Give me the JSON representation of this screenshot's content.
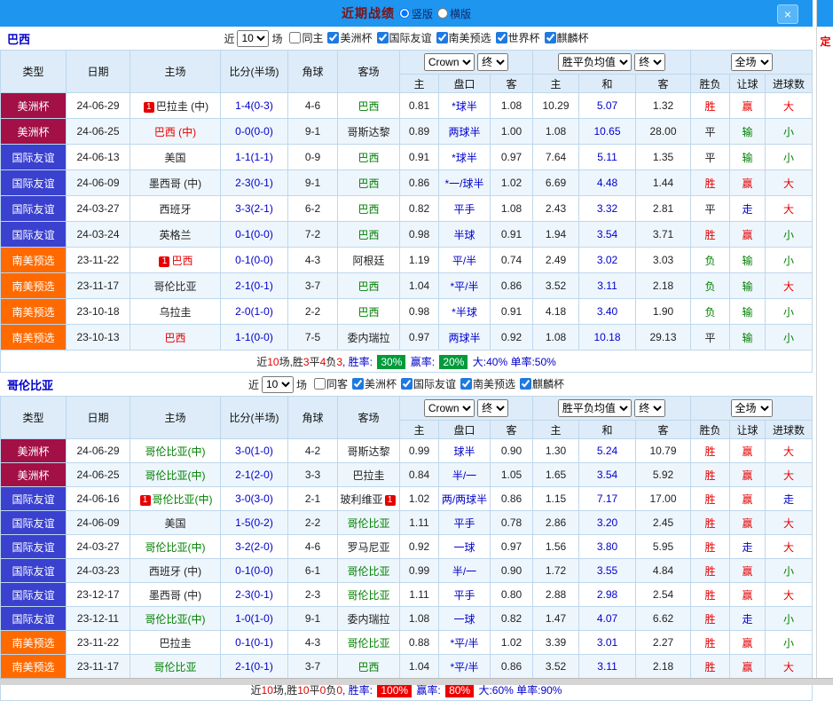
{
  "titlebar": {
    "title": "近期战绩",
    "radio1": "竖版",
    "radio2": "横版",
    "close": "×"
  },
  "side": {
    "label": "定"
  },
  "controls": {
    "near": "近",
    "games": "10",
    "games_suffix": "场",
    "company": "Crown",
    "end": "终",
    "wdl": "胜平负均值",
    "full": "全场"
  },
  "header_labels": {
    "type": "类型",
    "date": "日期",
    "home": "主场",
    "score": "比分(半场)",
    "corner": "角球",
    "away": "客场",
    "h1": "主",
    "h2": "盘口",
    "h3": "客",
    "h4": "主",
    "h5": "和",
    "h6": "客",
    "h7": "胜负",
    "h8": "让球",
    "h9": "进球数"
  },
  "sections": [
    {
      "team": "巴西",
      "filters": [
        {
          "label": "同主",
          "checked": false
        },
        {
          "label": "美洲杯",
          "checked": true
        },
        {
          "label": "国际友谊",
          "checked": true
        },
        {
          "label": "南美预选",
          "checked": true
        },
        {
          "label": "世界杯",
          "checked": true
        },
        {
          "label": "麒麟杯",
          "checked": true
        }
      ],
      "rows": [
        {
          "type": "美洲杯",
          "tclass": "copa",
          "date": "24-06-29",
          "home": "巴拉圭 (中)",
          "homeBadge": "1",
          "homeColor": "black",
          "score": "1-4(0-3)",
          "corner": "4-6",
          "away": "巴西",
          "awayBadge": "",
          "awayColor": "green",
          "aH": "0.81",
          "aP": "*球半",
          "aA": "1.08",
          "eH": "10.29",
          "eD": "5.07",
          "eA": "1.32",
          "res": "胜",
          "resC": "red",
          "han": "赢",
          "hanC": "red",
          "gol": "大",
          "golC": "red"
        },
        {
          "type": "美洲杯",
          "tclass": "copa",
          "date": "24-06-25",
          "home": "巴西 (中)",
          "homeBadge": "",
          "homeColor": "red",
          "score": "0-0(0-0)",
          "corner": "9-1",
          "away": "哥斯达黎",
          "awayBadge": "",
          "awayColor": "black",
          "aH": "0.89",
          "aP": "两球半",
          "aA": "1.00",
          "eH": "1.08",
          "eD": "10.65",
          "eA": "28.00",
          "res": "平",
          "resC": "black",
          "han": "输",
          "hanC": "green",
          "gol": "小",
          "golC": "green"
        },
        {
          "type": "国际友谊",
          "tclass": "friendly",
          "date": "24-06-13",
          "home": "美国",
          "homeBadge": "",
          "homeColor": "black",
          "score": "1-1(1-1)",
          "corner": "0-9",
          "away": "巴西",
          "awayBadge": "",
          "awayColor": "green",
          "aH": "0.91",
          "aP": "*球半",
          "aA": "0.97",
          "eH": "7.64",
          "eD": "5.11",
          "eA": "1.35",
          "res": "平",
          "resC": "black",
          "han": "输",
          "hanC": "green",
          "gol": "小",
          "golC": "green"
        },
        {
          "type": "国际友谊",
          "tclass": "friendly",
          "date": "24-06-09",
          "home": "墨西哥 (中)",
          "homeBadge": "",
          "homeColor": "black",
          "score": "2-3(0-1)",
          "corner": "9-1",
          "away": "巴西",
          "awayBadge": "",
          "awayColor": "green",
          "aH": "0.86",
          "aP": "*一/球半",
          "aA": "1.02",
          "eH": "6.69",
          "eD": "4.48",
          "eA": "1.44",
          "res": "胜",
          "resC": "red",
          "han": "赢",
          "hanC": "red",
          "gol": "大",
          "golC": "red"
        },
        {
          "type": "国际友谊",
          "tclass": "friendly",
          "date": "24-03-27",
          "home": "西班牙",
          "homeBadge": "",
          "homeColor": "black",
          "score": "3-3(2-1)",
          "corner": "6-2",
          "away": "巴西",
          "awayBadge": "",
          "awayColor": "green",
          "aH": "0.82",
          "aP": "平手",
          "aA": "1.08",
          "eH": "2.43",
          "eD": "3.32",
          "eA": "2.81",
          "res": "平",
          "resC": "black",
          "han": "走",
          "hanC": "blue",
          "gol": "大",
          "golC": "red"
        },
        {
          "type": "国际友谊",
          "tclass": "friendly",
          "date": "24-03-24",
          "home": "英格兰",
          "homeBadge": "",
          "homeColor": "black",
          "score": "0-1(0-0)",
          "corner": "7-2",
          "away": "巴西",
          "awayBadge": "",
          "awayColor": "green",
          "aH": "0.98",
          "aP": "半球",
          "aA": "0.91",
          "eH": "1.94",
          "eD": "3.54",
          "eA": "3.71",
          "res": "胜",
          "resC": "red",
          "han": "赢",
          "hanC": "red",
          "gol": "小",
          "golC": "green"
        },
        {
          "type": "南美预选",
          "tclass": "qual",
          "date": "23-11-22",
          "home": "巴西",
          "homeBadge": "1",
          "homeColor": "red",
          "score": "0-1(0-0)",
          "corner": "4-3",
          "away": "阿根廷",
          "awayBadge": "",
          "awayColor": "black",
          "aH": "1.19",
          "aP": "平/半",
          "aA": "0.74",
          "eH": "2.49",
          "eD": "3.02",
          "eA": "3.03",
          "res": "负",
          "resC": "green",
          "han": "输",
          "hanC": "green",
          "gol": "小",
          "golC": "green"
        },
        {
          "type": "南美预选",
          "tclass": "qual",
          "date": "23-11-17",
          "home": "哥伦比亚",
          "homeBadge": "",
          "homeColor": "black",
          "score": "2-1(0-1)",
          "corner": "3-7",
          "away": "巴西",
          "awayBadge": "",
          "awayColor": "green",
          "aH": "1.04",
          "aP": "*平/半",
          "aA": "0.86",
          "eH": "3.52",
          "eD": "3.11",
          "eA": "2.18",
          "res": "负",
          "resC": "green",
          "han": "输",
          "hanC": "green",
          "gol": "大",
          "golC": "red"
        },
        {
          "type": "南美预选",
          "tclass": "qual",
          "date": "23-10-18",
          "home": "乌拉圭",
          "homeBadge": "",
          "homeColor": "black",
          "score": "2-0(1-0)",
          "corner": "2-2",
          "away": "巴西",
          "awayBadge": "",
          "awayColor": "green",
          "aH": "0.98",
          "aP": "*半球",
          "aA": "0.91",
          "eH": "4.18",
          "eD": "3.40",
          "eA": "1.90",
          "res": "负",
          "resC": "green",
          "han": "输",
          "hanC": "green",
          "gol": "小",
          "golC": "green"
        },
        {
          "type": "南美预选",
          "tclass": "qual",
          "date": "23-10-13",
          "home": "巴西",
          "homeBadge": "",
          "homeColor": "red",
          "score": "1-1(0-0)",
          "corner": "7-5",
          "away": "委内瑞拉",
          "awayBadge": "",
          "awayColor": "black",
          "aH": "0.97",
          "aP": "两球半",
          "aA": "0.92",
          "eH": "1.08",
          "eD": "10.18",
          "eA": "29.13",
          "res": "平",
          "resC": "black",
          "han": "输",
          "hanC": "green",
          "gol": "小",
          "golC": "green"
        }
      ],
      "summary": [
        {
          "t": "近",
          "c": "k"
        },
        {
          "t": "10",
          "c": "r"
        },
        {
          "t": "场,胜",
          "c": "k"
        },
        {
          "t": "3",
          "c": "r"
        },
        {
          "t": "平",
          "c": "k"
        },
        {
          "t": "4",
          "c": "r"
        },
        {
          "t": "负",
          "c": "k"
        },
        {
          "t": "3",
          "c": "r"
        },
        {
          "t": ", 胜率: ",
          "c": "b"
        },
        {
          "t": "30%",
          "c": "pg"
        },
        {
          "t": " 赢率: ",
          "c": "b"
        },
        {
          "t": "20%",
          "c": "pg"
        },
        {
          "t": " 大:40% 单率:50%",
          "c": "b"
        }
      ]
    },
    {
      "team": "哥伦比亚",
      "filters": [
        {
          "label": "同客",
          "checked": false
        },
        {
          "label": "美洲杯",
          "checked": true
        },
        {
          "label": "国际友谊",
          "checked": true
        },
        {
          "label": "南美预选",
          "checked": true
        },
        {
          "label": "麒麟杯",
          "checked": true
        }
      ],
      "rows": [
        {
          "type": "美洲杯",
          "tclass": "copa",
          "date": "24-06-29",
          "home": "哥伦比亚(中)",
          "homeBadge": "",
          "homeColor": "green",
          "score": "3-0(1-0)",
          "corner": "4-2",
          "away": "哥斯达黎",
          "awayBadge": "",
          "awayColor": "black",
          "aH": "0.99",
          "aP": "球半",
          "aA": "0.90",
          "eH": "1.30",
          "eD": "5.24",
          "eA": "10.79",
          "res": "胜",
          "resC": "red",
          "han": "赢",
          "hanC": "red",
          "gol": "大",
          "golC": "red"
        },
        {
          "type": "美洲杯",
          "tclass": "copa",
          "date": "24-06-25",
          "home": "哥伦比亚(中)",
          "homeBadge": "",
          "homeColor": "green",
          "score": "2-1(2-0)",
          "corner": "3-3",
          "away": "巴拉圭",
          "awayBadge": "",
          "awayColor": "black",
          "aH": "0.84",
          "aP": "半/一",
          "aA": "1.05",
          "eH": "1.65",
          "eD": "3.54",
          "eA": "5.92",
          "res": "胜",
          "resC": "red",
          "han": "赢",
          "hanC": "red",
          "gol": "大",
          "golC": "red"
        },
        {
          "type": "国际友谊",
          "tclass": "friendly",
          "date": "24-06-16",
          "home": "哥伦比亚(中)",
          "homeBadge": "1",
          "homeColor": "green",
          "score": "3-0(3-0)",
          "corner": "2-1",
          "away": "玻利维亚",
          "awayBadge": "1",
          "awayColor": "black",
          "aH": "1.02",
          "aP": "两/两球半",
          "aA": "0.86",
          "eH": "1.15",
          "eD": "7.17",
          "eA": "17.00",
          "res": "胜",
          "resC": "red",
          "han": "赢",
          "hanC": "red",
          "gol": "走",
          "golC": "blue"
        },
        {
          "type": "国际友谊",
          "tclass": "friendly",
          "date": "24-06-09",
          "home": "美国",
          "homeBadge": "",
          "homeColor": "black",
          "score": "1-5(0-2)",
          "corner": "2-2",
          "away": "哥伦比亚",
          "awayBadge": "",
          "awayColor": "green",
          "aH": "1.11",
          "aP": "平手",
          "aA": "0.78",
          "eH": "2.86",
          "eD": "3.20",
          "eA": "2.45",
          "res": "胜",
          "resC": "red",
          "han": "赢",
          "hanC": "red",
          "gol": "大",
          "golC": "red"
        },
        {
          "type": "国际友谊",
          "tclass": "friendly",
          "date": "24-03-27",
          "home": "哥伦比亚(中)",
          "homeBadge": "",
          "homeColor": "green",
          "score": "3-2(2-0)",
          "corner": "4-6",
          "away": "罗马尼亚",
          "awayBadge": "",
          "awayColor": "black",
          "aH": "0.92",
          "aP": "一球",
          "aA": "0.97",
          "eH": "1.56",
          "eD": "3.80",
          "eA": "5.95",
          "res": "胜",
          "resC": "red",
          "han": "走",
          "hanC": "blue",
          "gol": "大",
          "golC": "red"
        },
        {
          "type": "国际友谊",
          "tclass": "friendly",
          "date": "24-03-23",
          "home": "西班牙 (中)",
          "homeBadge": "",
          "homeColor": "black",
          "score": "0-1(0-0)",
          "corner": "6-1",
          "away": "哥伦比亚",
          "awayBadge": "",
          "awayColor": "green",
          "aH": "0.99",
          "aP": "半/一",
          "aA": "0.90",
          "eH": "1.72",
          "eD": "3.55",
          "eA": "4.84",
          "res": "胜",
          "resC": "red",
          "han": "赢",
          "hanC": "red",
          "gol": "小",
          "golC": "green"
        },
        {
          "type": "国际友谊",
          "tclass": "friendly",
          "date": "23-12-17",
          "home": "墨西哥 (中)",
          "homeBadge": "",
          "homeColor": "black",
          "score": "2-3(0-1)",
          "corner": "2-3",
          "away": "哥伦比亚",
          "awayBadge": "",
          "awayColor": "green",
          "aH": "1.11",
          "aP": "平手",
          "aA": "0.80",
          "eH": "2.88",
          "eD": "2.98",
          "eA": "2.54",
          "res": "胜",
          "resC": "red",
          "han": "赢",
          "hanC": "red",
          "gol": "大",
          "golC": "red"
        },
        {
          "type": "国际友谊",
          "tclass": "friendly",
          "date": "23-12-11",
          "home": "哥伦比亚(中)",
          "homeBadge": "",
          "homeColor": "green",
          "score": "1-0(1-0)",
          "corner": "9-1",
          "away": "委内瑞拉",
          "awayBadge": "",
          "awayColor": "black",
          "aH": "1.08",
          "aP": "一球",
          "aA": "0.82",
          "eH": "1.47",
          "eD": "4.07",
          "eA": "6.62",
          "res": "胜",
          "resC": "red",
          "han": "走",
          "hanC": "blue",
          "gol": "小",
          "golC": "green"
        },
        {
          "type": "南美预选",
          "tclass": "qual",
          "date": "23-11-22",
          "home": "巴拉圭",
          "homeBadge": "",
          "homeColor": "black",
          "score": "0-1(0-1)",
          "corner": "4-3",
          "away": "哥伦比亚",
          "awayBadge": "",
          "awayColor": "green",
          "aH": "0.88",
          "aP": "*平/半",
          "aA": "1.02",
          "eH": "3.39",
          "eD": "3.01",
          "eA": "2.27",
          "res": "胜",
          "resC": "red",
          "han": "赢",
          "hanC": "red",
          "gol": "小",
          "golC": "green"
        },
        {
          "type": "南美预选",
          "tclass": "qual",
          "date": "23-11-17",
          "home": "哥伦比亚",
          "homeBadge": "",
          "homeColor": "green",
          "score": "2-1(0-1)",
          "corner": "3-7",
          "away": "巴西",
          "awayBadge": "",
          "awayColor": "green",
          "aH": "1.04",
          "aP": "*平/半",
          "aA": "0.86",
          "eH": "3.52",
          "eD": "3.11",
          "eA": "2.18",
          "res": "胜",
          "resC": "red",
          "han": "赢",
          "hanC": "red",
          "gol": "大",
          "golC": "red"
        }
      ],
      "summary": [
        {
          "t": "近",
          "c": "k"
        },
        {
          "t": "10",
          "c": "r"
        },
        {
          "t": "场,胜",
          "c": "k"
        },
        {
          "t": "10",
          "c": "r"
        },
        {
          "t": "平",
          "c": "k"
        },
        {
          "t": "0",
          "c": "r"
        },
        {
          "t": "负",
          "c": "k"
        },
        {
          "t": "0",
          "c": "r"
        },
        {
          "t": ", 胜率: ",
          "c": "b"
        },
        {
          "t": "100%",
          "c": "pr"
        },
        {
          "t": " 赢率: ",
          "c": "b"
        },
        {
          "t": "80%",
          "c": "pr"
        },
        {
          "t": " 大:60% 单率:90%",
          "c": "b"
        }
      ]
    }
  ]
}
